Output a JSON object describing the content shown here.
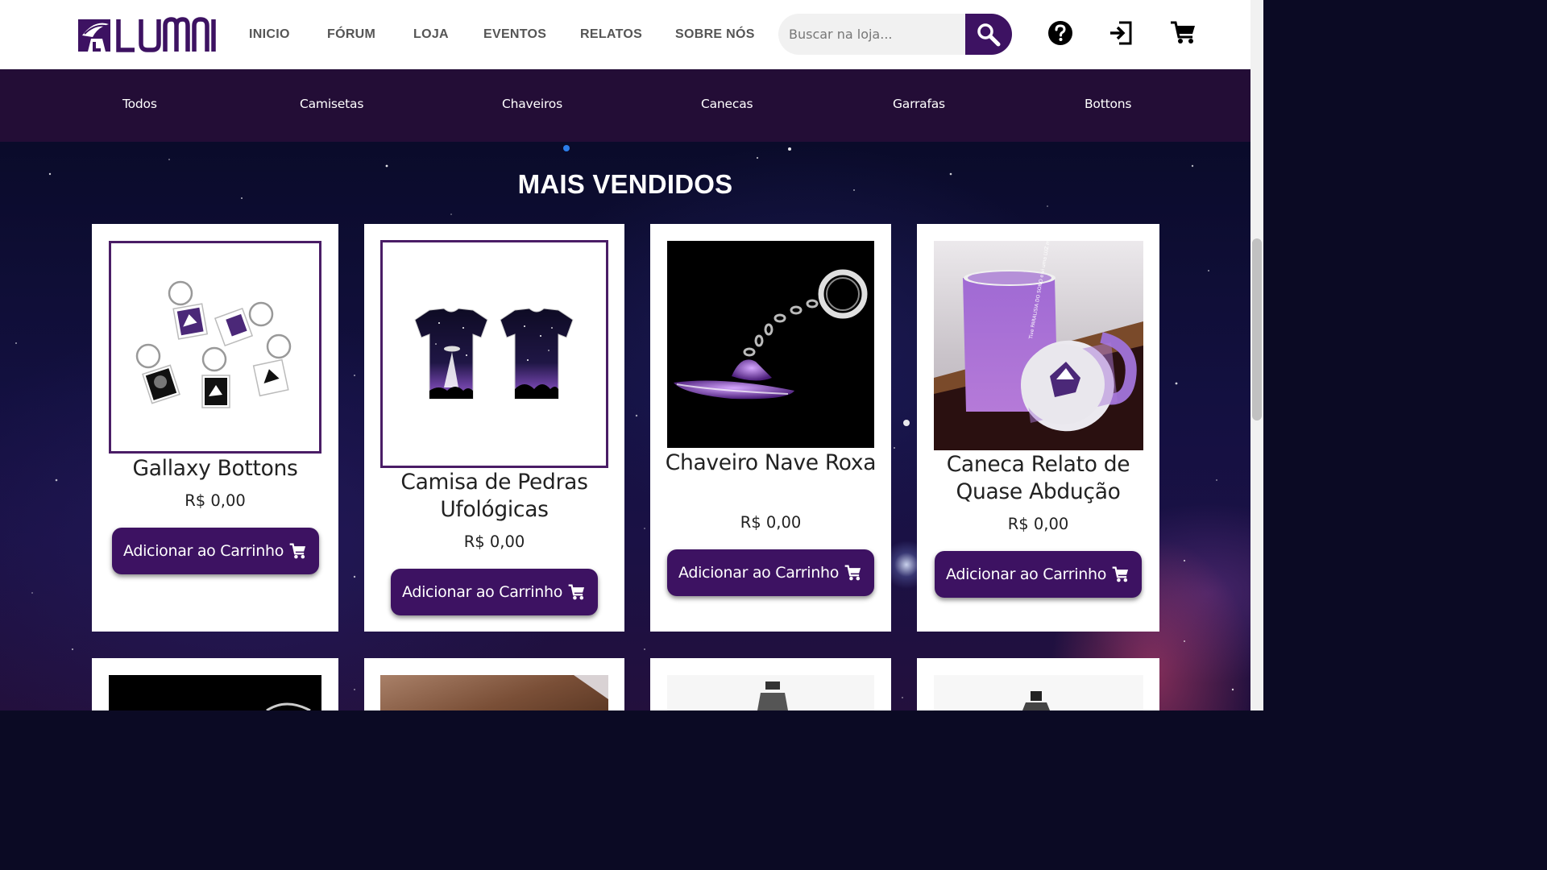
{
  "nav": {
    "logo_text": "LUMNI",
    "links": [
      "INICIO",
      "FÓRUM",
      "LOJA",
      "EVENTOS",
      "RELATOS",
      "SOBRE NÓS"
    ],
    "search_placeholder": "Buscar na loja...",
    "icons": [
      "search-icon",
      "help-icon",
      "login-icon",
      "cart-icon"
    ]
  },
  "categories": [
    "Todos",
    "Camisetas",
    "Chaveiros",
    "Canecas",
    "Garrafas",
    "Bottons"
  ],
  "section_title": "MAIS VENDIDOS",
  "products": [
    {
      "name": "Gallaxy Bottons",
      "price": "R$ 0,00",
      "button": "Adicionar ao Carrinho"
    },
    {
      "name": "Camisa de Pedras Ufológicas",
      "price": "R$ 0,00",
      "button": "Adicionar ao Carrinho"
    },
    {
      "name": "Chaveiro Nave Roxa",
      "price": "R$ 0,00",
      "button": "Adicionar ao Carrinho"
    },
    {
      "name": "Caneca Relato de Quase Abdução",
      "price": "R$ 0,00",
      "button": "Adicionar ao Carrinho"
    }
  ],
  "mug_text": "Tive PARALISIA DO SONO e vi uma LUZ me sugando pela janela... Até hoje não sei se foi SONHO ou se foi REAL",
  "colors": {
    "brand_purple": "#3d1262",
    "category_bar": "#230d36",
    "active_dot": "#2b7de9"
  }
}
